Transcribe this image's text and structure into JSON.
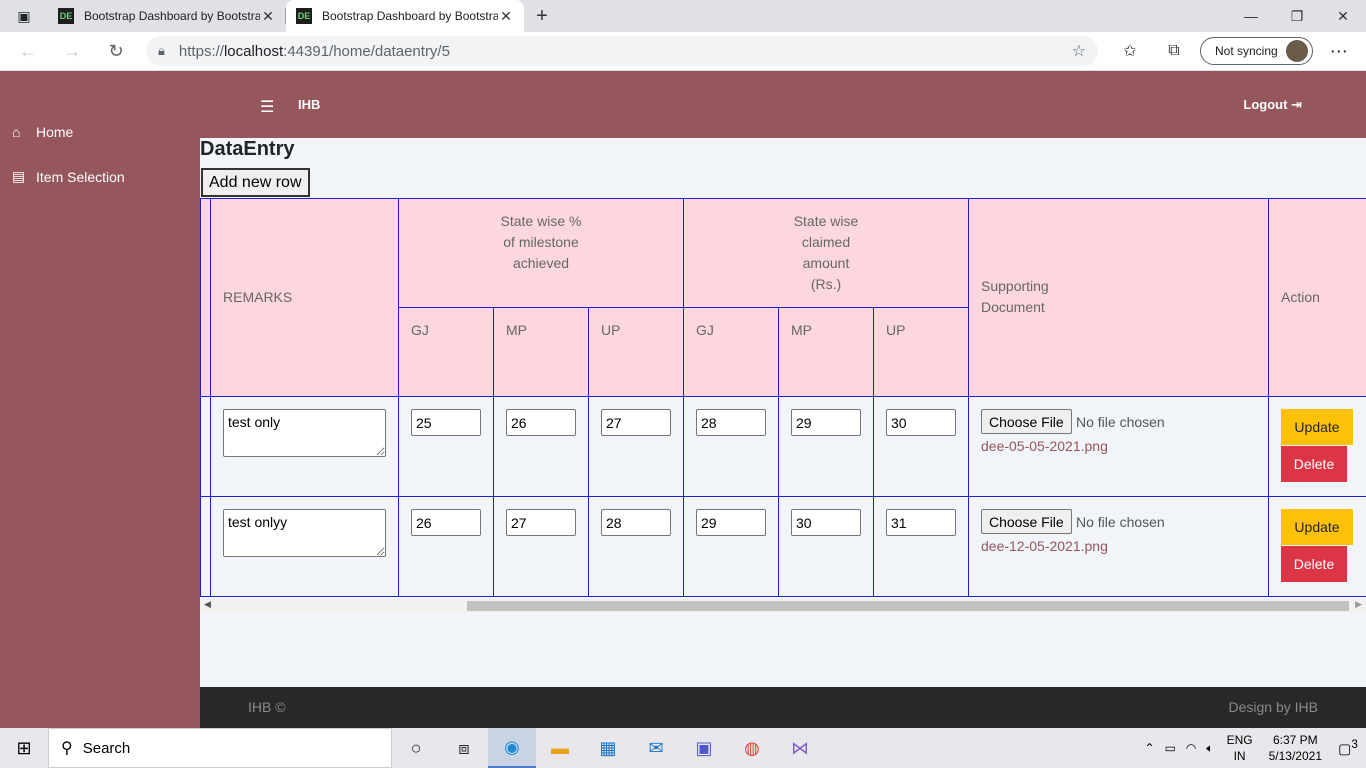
{
  "browser": {
    "tabs": [
      {
        "favicon": "DE",
        "title": "Bootstrap Dashboard by Bootstrap"
      },
      {
        "favicon": "DE",
        "title": "Bootstrap Dashboard by Bootstrap"
      }
    ],
    "new_tab_label": "+",
    "url_prefix": "https://",
    "url_host": "localhost",
    "url_rest": ":44391/home/dataentry/5",
    "sync_label": "Not syncing"
  },
  "sidebar": {
    "items": [
      {
        "label": "Home",
        "icon": "home-icon"
      },
      {
        "label": "Item Selection",
        "icon": "clipboard-icon"
      }
    ]
  },
  "topbar": {
    "brand": "IHB",
    "logout": "Logout"
  },
  "page": {
    "title": "DataEntry",
    "add_row_label": "Add new row"
  },
  "table": {
    "headers": {
      "remarks": "REMARKS",
      "pct_group": [
        "State wise %",
        "of milestone",
        "achieved"
      ],
      "amt_group": [
        "State wise",
        "claimed",
        "amount",
        "(Rs.)"
      ],
      "supporting": [
        "Supporting",
        "Document"
      ],
      "action": "Action",
      "pct_states": [
        "GJ",
        "MP",
        "UP"
      ],
      "amt_states": [
        "GJ",
        "MP",
        "UP"
      ]
    },
    "rows": [
      {
        "remarks": "test only",
        "pct": [
          "25",
          "26",
          "27"
        ],
        "amt": [
          "28",
          "29",
          "30"
        ],
        "file_button": "Choose File",
        "file_status": "No file chosen",
        "document": "dee-05-05-2021.png",
        "update_label": "Update",
        "delete_label": "Delete"
      },
      {
        "remarks": "test onlyy",
        "pct": [
          "26",
          "27",
          "28"
        ],
        "amt": [
          "29",
          "30",
          "31"
        ],
        "file_button": "Choose File",
        "file_status": "No file chosen",
        "document": "dee-12-05-2021.png",
        "update_label": "Update",
        "delete_label": "Delete"
      }
    ]
  },
  "footer": {
    "left": "IHB ©",
    "right": "Design by IHB"
  },
  "taskbar": {
    "search_label": "Search",
    "language": "ENG",
    "region": "IN",
    "time": "6:37 PM",
    "date": "5/13/2021",
    "notifications": "3"
  },
  "colors": {
    "brand": "#95565c",
    "header_bg": "#fcd7de",
    "grid_border": "#1f1fd0",
    "update": "#ffc107",
    "delete": "#dc3545"
  }
}
